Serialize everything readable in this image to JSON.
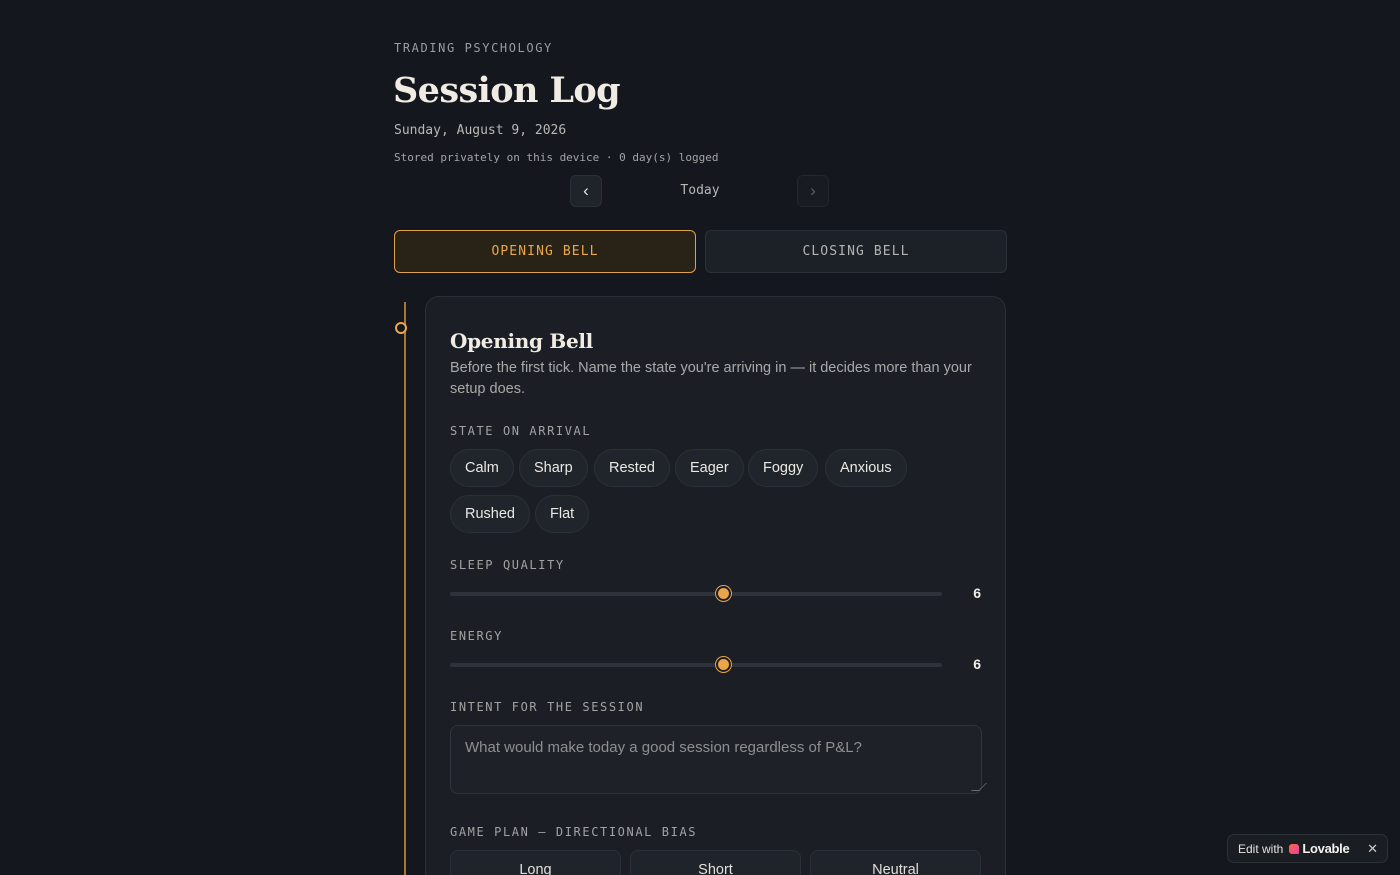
{
  "header": {
    "eyebrow": "TRADING PSYCHOLOGY",
    "title": "Session Log",
    "date": "Sunday, August 9, 2026",
    "meta": "Stored privately on this device · 0 day(s) logged"
  },
  "day_nav": {
    "prev_icon": "chevron-left-icon",
    "prev_glyph": "‹",
    "label": "Today",
    "next_icon": "chevron-right-icon",
    "next_glyph": "›"
  },
  "tabs": [
    {
      "label": "OPENING BELL",
      "active": true
    },
    {
      "label": "CLOSING BELL",
      "active": false
    }
  ],
  "card": {
    "title": "Opening Bell",
    "description": "Before the first tick. Name the state you're arriving in — it decides more than your setup does.",
    "state_label": "STATE ON ARRIVAL",
    "states": [
      "Calm",
      "Sharp",
      "Rested",
      "Eager",
      "Foggy",
      "Anxious",
      "Rushed",
      "Flat"
    ],
    "sleep": {
      "label": "SLEEP QUALITY",
      "value": 6,
      "min": 1,
      "max": 10,
      "display": "6"
    },
    "energy": {
      "label": "ENERGY",
      "value": 6,
      "min": 1,
      "max": 10,
      "display": "6"
    },
    "intent": {
      "label": "INTENT FOR THE SESSION",
      "placeholder": "What would make today a good session regardless of P&L?"
    },
    "bias": {
      "label": "GAME PLAN — DIRECTIONAL BIAS",
      "options": [
        "Long",
        "Short",
        "Neutral"
      ]
    }
  },
  "badge": {
    "prefix": "Edit with",
    "brand": "Lovable",
    "close_glyph": "✕"
  },
  "colors": {
    "background": "#14171d",
    "accent": "#e9a84a",
    "card": "#1b1e24"
  }
}
